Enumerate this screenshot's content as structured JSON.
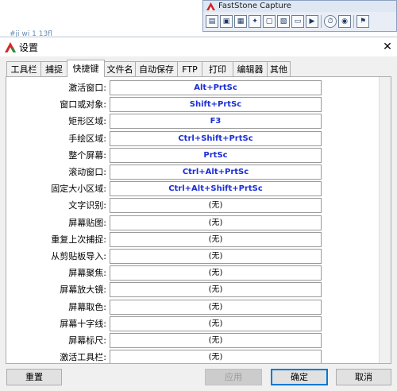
{
  "background": {
    "fragment_text": "#ji wi 1 13fl"
  },
  "faststone": {
    "title": "FastStone Capture",
    "tools": [
      {
        "icon": "open-folder-icon",
        "glyph": "▤"
      },
      {
        "icon": "capture-window-icon",
        "glyph": "▣"
      },
      {
        "icon": "capture-object-icon",
        "glyph": "▦"
      },
      {
        "icon": "capture-freehand-icon",
        "glyph": "✦"
      },
      {
        "icon": "capture-fullscreen-icon",
        "glyph": "▢"
      },
      {
        "icon": "capture-fixed-region-icon",
        "glyph": "▧"
      },
      {
        "icon": "capture-scrolling-icon",
        "glyph": "▭"
      },
      {
        "icon": "screen-recorder-icon",
        "glyph": "▶"
      },
      {
        "icon": "delay-timer-icon",
        "glyph": "⏱"
      },
      {
        "icon": "output-settings-icon",
        "glyph": "◉"
      },
      {
        "icon": "settings-menu-icon",
        "glyph": "⚑"
      }
    ]
  },
  "dialog": {
    "title": "设置",
    "tabs": [
      {
        "label": "工具栏"
      },
      {
        "label": "捕捉"
      },
      {
        "label": "快捷键"
      },
      {
        "label": "文件名"
      },
      {
        "label": "自动保存"
      },
      {
        "label": "FTP"
      },
      {
        "label": "打印"
      },
      {
        "label": "编辑器"
      },
      {
        "label": "其他"
      }
    ],
    "active_tab": "快捷键",
    "hotkeys": [
      {
        "label": "激活窗口:",
        "value": "Alt+PrtSc"
      },
      {
        "label": "窗口或对象:",
        "value": "Shift+PrtSc"
      },
      {
        "label": "矩形区域:",
        "value": "F3"
      },
      {
        "label": "手绘区域:",
        "value": "Ctrl+Shift+PrtSc"
      },
      {
        "label": "整个屏幕:",
        "value": "PrtSc"
      },
      {
        "label": "滚动窗口:",
        "value": "Ctrl+Alt+PrtSc"
      },
      {
        "label": "固定大小区域:",
        "value": "Ctrl+Alt+Shift+PrtSc"
      },
      {
        "label": "文字识别:",
        "value": "(无)"
      },
      {
        "label": "屏幕贴图:",
        "value": "(无)"
      },
      {
        "label": "重复上次捕捉:",
        "value": "(无)"
      },
      {
        "label": "从剪贴板导入:",
        "value": "(无)"
      },
      {
        "label": "屏幕聚焦:",
        "value": "(无)"
      },
      {
        "label": "屏幕放大镜:",
        "value": "(无)"
      },
      {
        "label": "屏幕取色:",
        "value": "(无)"
      },
      {
        "label": "屏幕十字线:",
        "value": "(无)"
      },
      {
        "label": "屏幕标尺:",
        "value": "(无)"
      },
      {
        "label": "激活工具栏:",
        "value": "(无)"
      }
    ],
    "buttons": {
      "reset": "重置",
      "apply": "应用",
      "ok": "确定",
      "cancel": "取消"
    }
  },
  "colors": {
    "hotkey_text": "#1a2ed6",
    "default_button_border": "#0078d7"
  }
}
